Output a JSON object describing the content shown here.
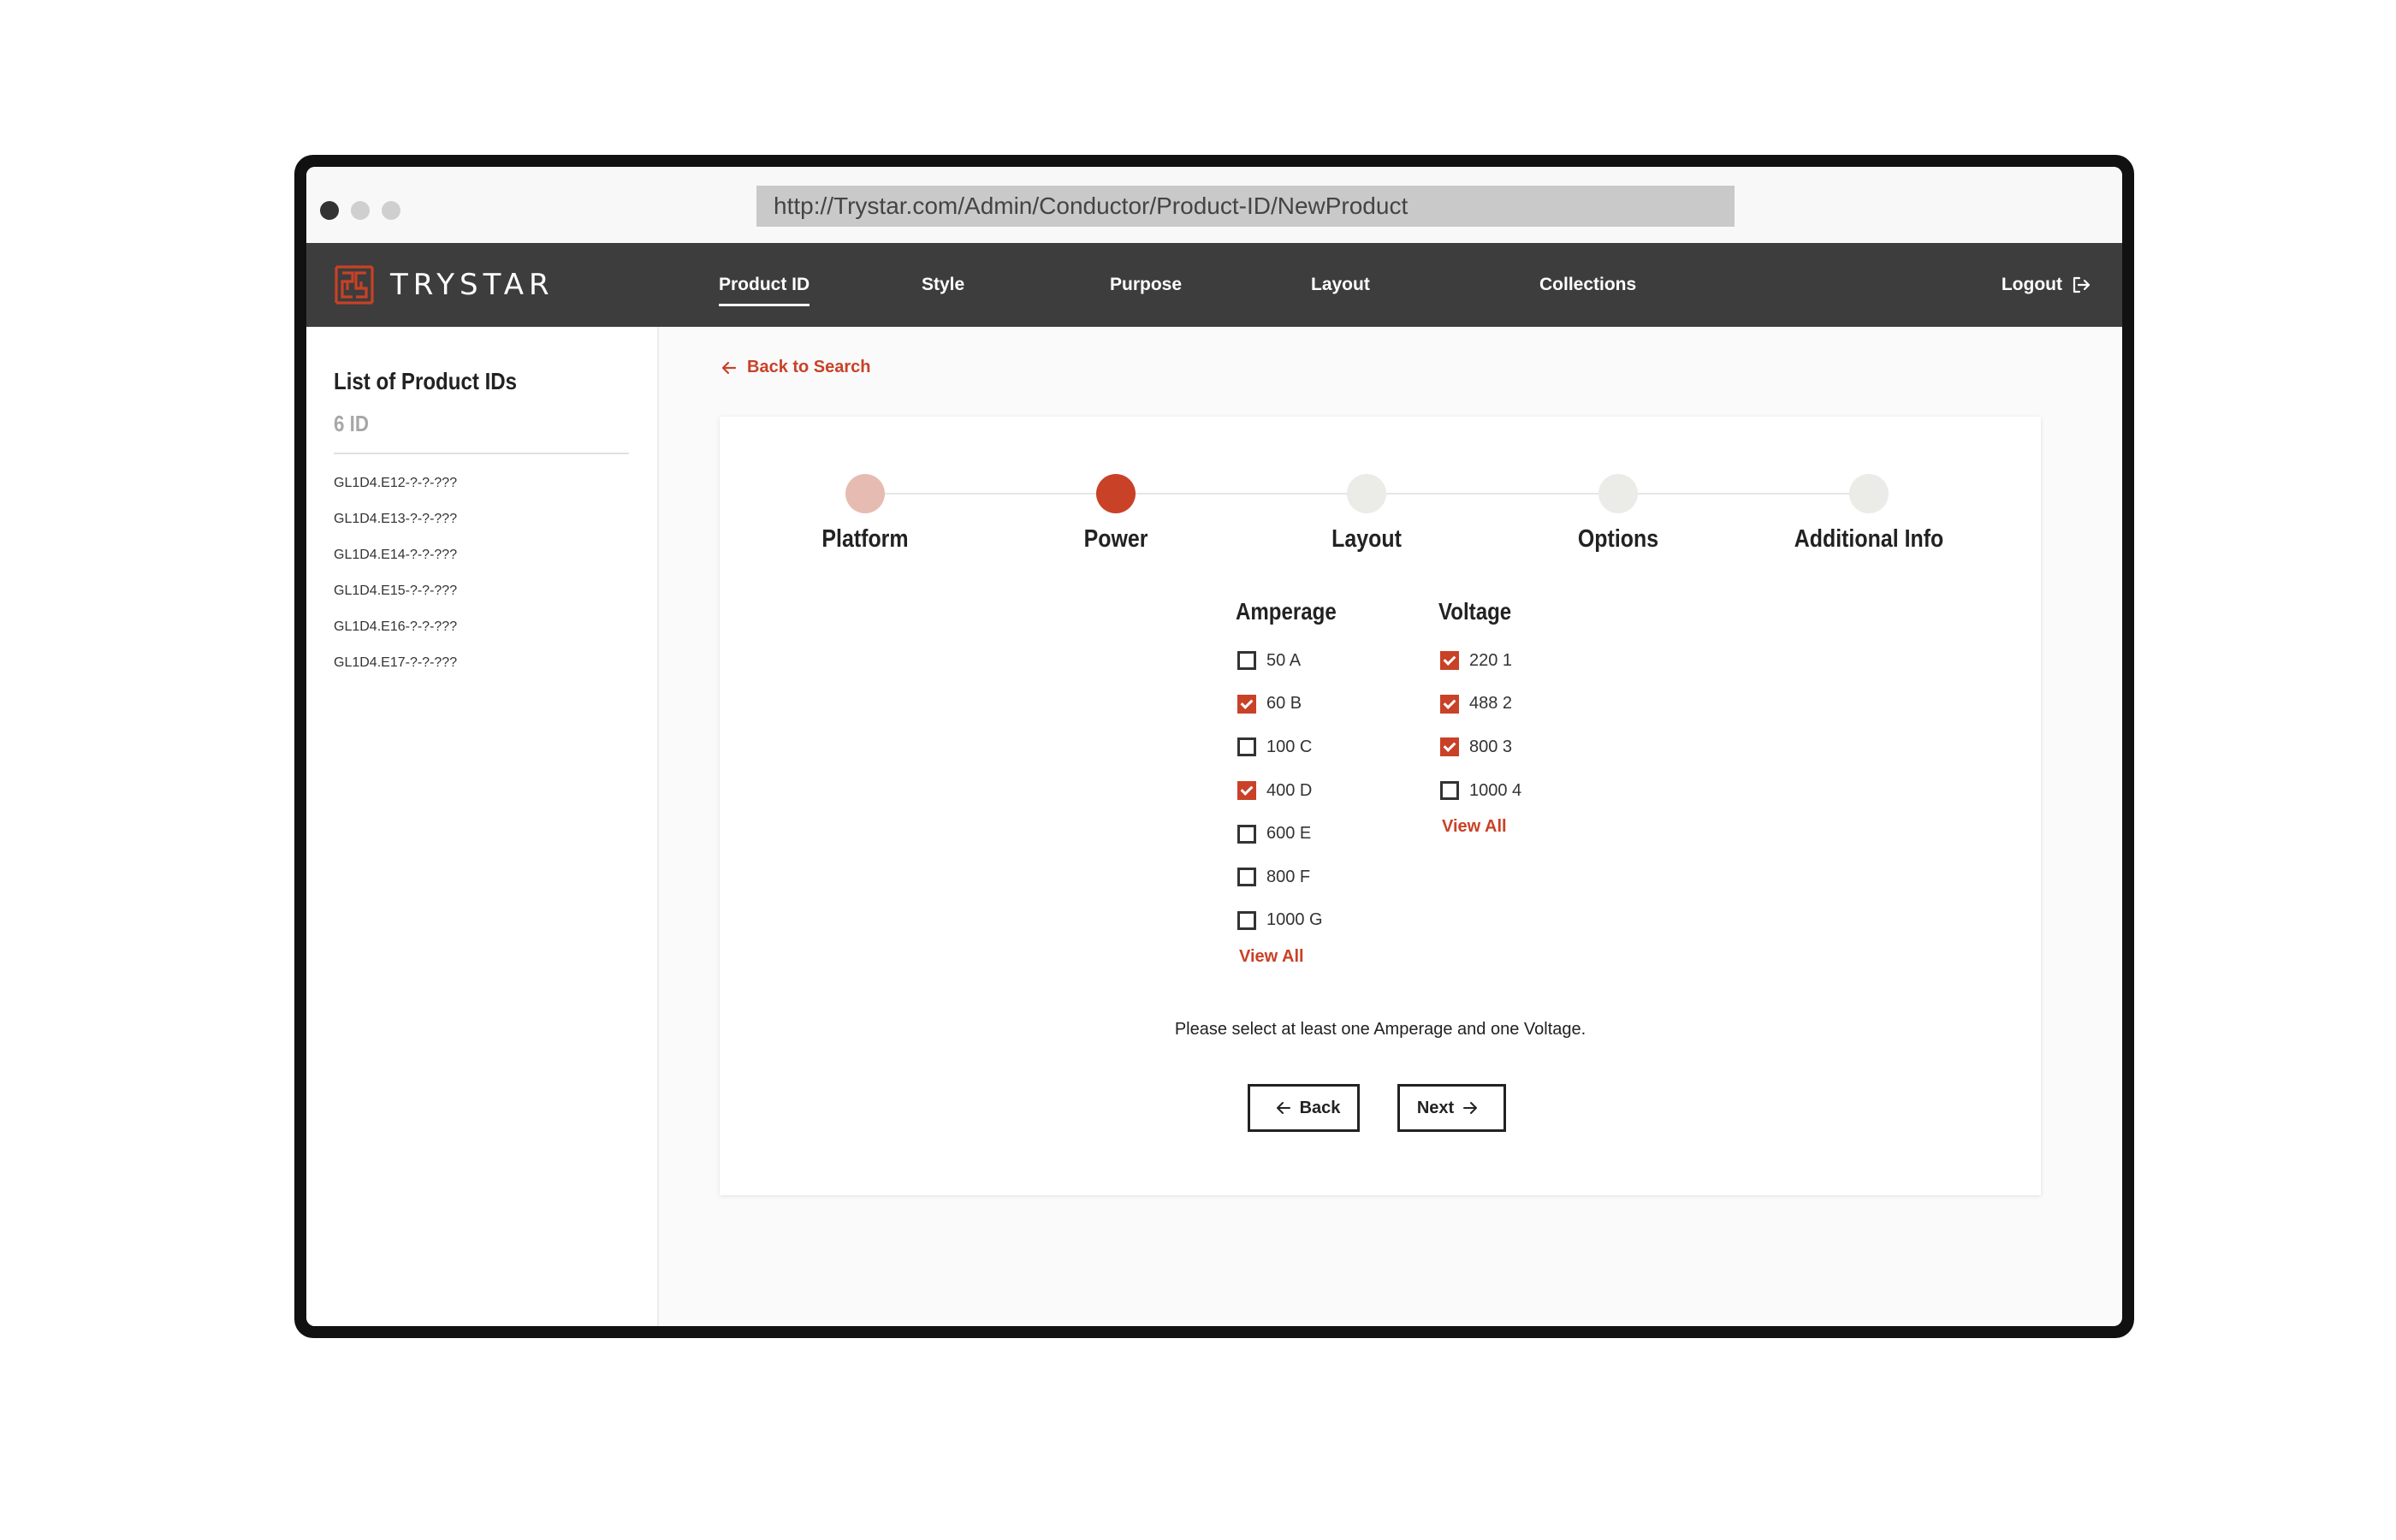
{
  "browser": {
    "url": "http://Trystar.com/Admin/Conductor/Product-ID/NewProduct"
  },
  "navbar": {
    "logo_text": "TRYSTAR",
    "items": [
      {
        "label": "Product ID",
        "active": true
      },
      {
        "label": "Style",
        "active": false
      },
      {
        "label": "Purpose",
        "active": false
      },
      {
        "label": "Layout",
        "active": false
      },
      {
        "label": "Collections",
        "active": false
      }
    ],
    "logout_label": "Logout"
  },
  "sidebar": {
    "title": "List of Product IDs",
    "count": "6 ID",
    "items": [
      "GL1D4.E12-?-?-???",
      "GL1D4.E13-?-?-???",
      "GL1D4.E14-?-?-???",
      "GL1D4.E15-?-?-???",
      "GL1D4.E16-?-?-???",
      "GL1D4.E17-?-?-???"
    ]
  },
  "main": {
    "back_link": "Back to Search",
    "steps": [
      {
        "label": "Platform",
        "state": "done"
      },
      {
        "label": "Power",
        "state": "current"
      },
      {
        "label": "Layout",
        "state": "pending"
      },
      {
        "label": "Options",
        "state": "pending"
      },
      {
        "label": "Additional Info",
        "state": "pending"
      }
    ],
    "amperage": {
      "title": "Amperage",
      "options": [
        {
          "label": "50 A",
          "checked": false
        },
        {
          "label": "60 B",
          "checked": true
        },
        {
          "label": "100 C",
          "checked": false
        },
        {
          "label": "400 D",
          "checked": true
        },
        {
          "label": "600 E",
          "checked": false
        },
        {
          "label": "800 F",
          "checked": false
        },
        {
          "label": "1000 G",
          "checked": false
        }
      ],
      "view_all": "View All"
    },
    "voltage": {
      "title": "Voltage",
      "options": [
        {
          "label": "220 1",
          "checked": true
        },
        {
          "label": "488 2",
          "checked": true
        },
        {
          "label": "800 3",
          "checked": true
        },
        {
          "label": "1000 4",
          "checked": false
        }
      ],
      "view_all": "View All"
    },
    "hint": "Please select at least one Amperage and one Voltage.",
    "back_button": "Back",
    "next_button": "Next"
  },
  "colors": {
    "accent": "#c94127",
    "navbar": "#3c3d3c",
    "step_done": "#e6bcb2",
    "step_pending": "#ebebe8"
  }
}
